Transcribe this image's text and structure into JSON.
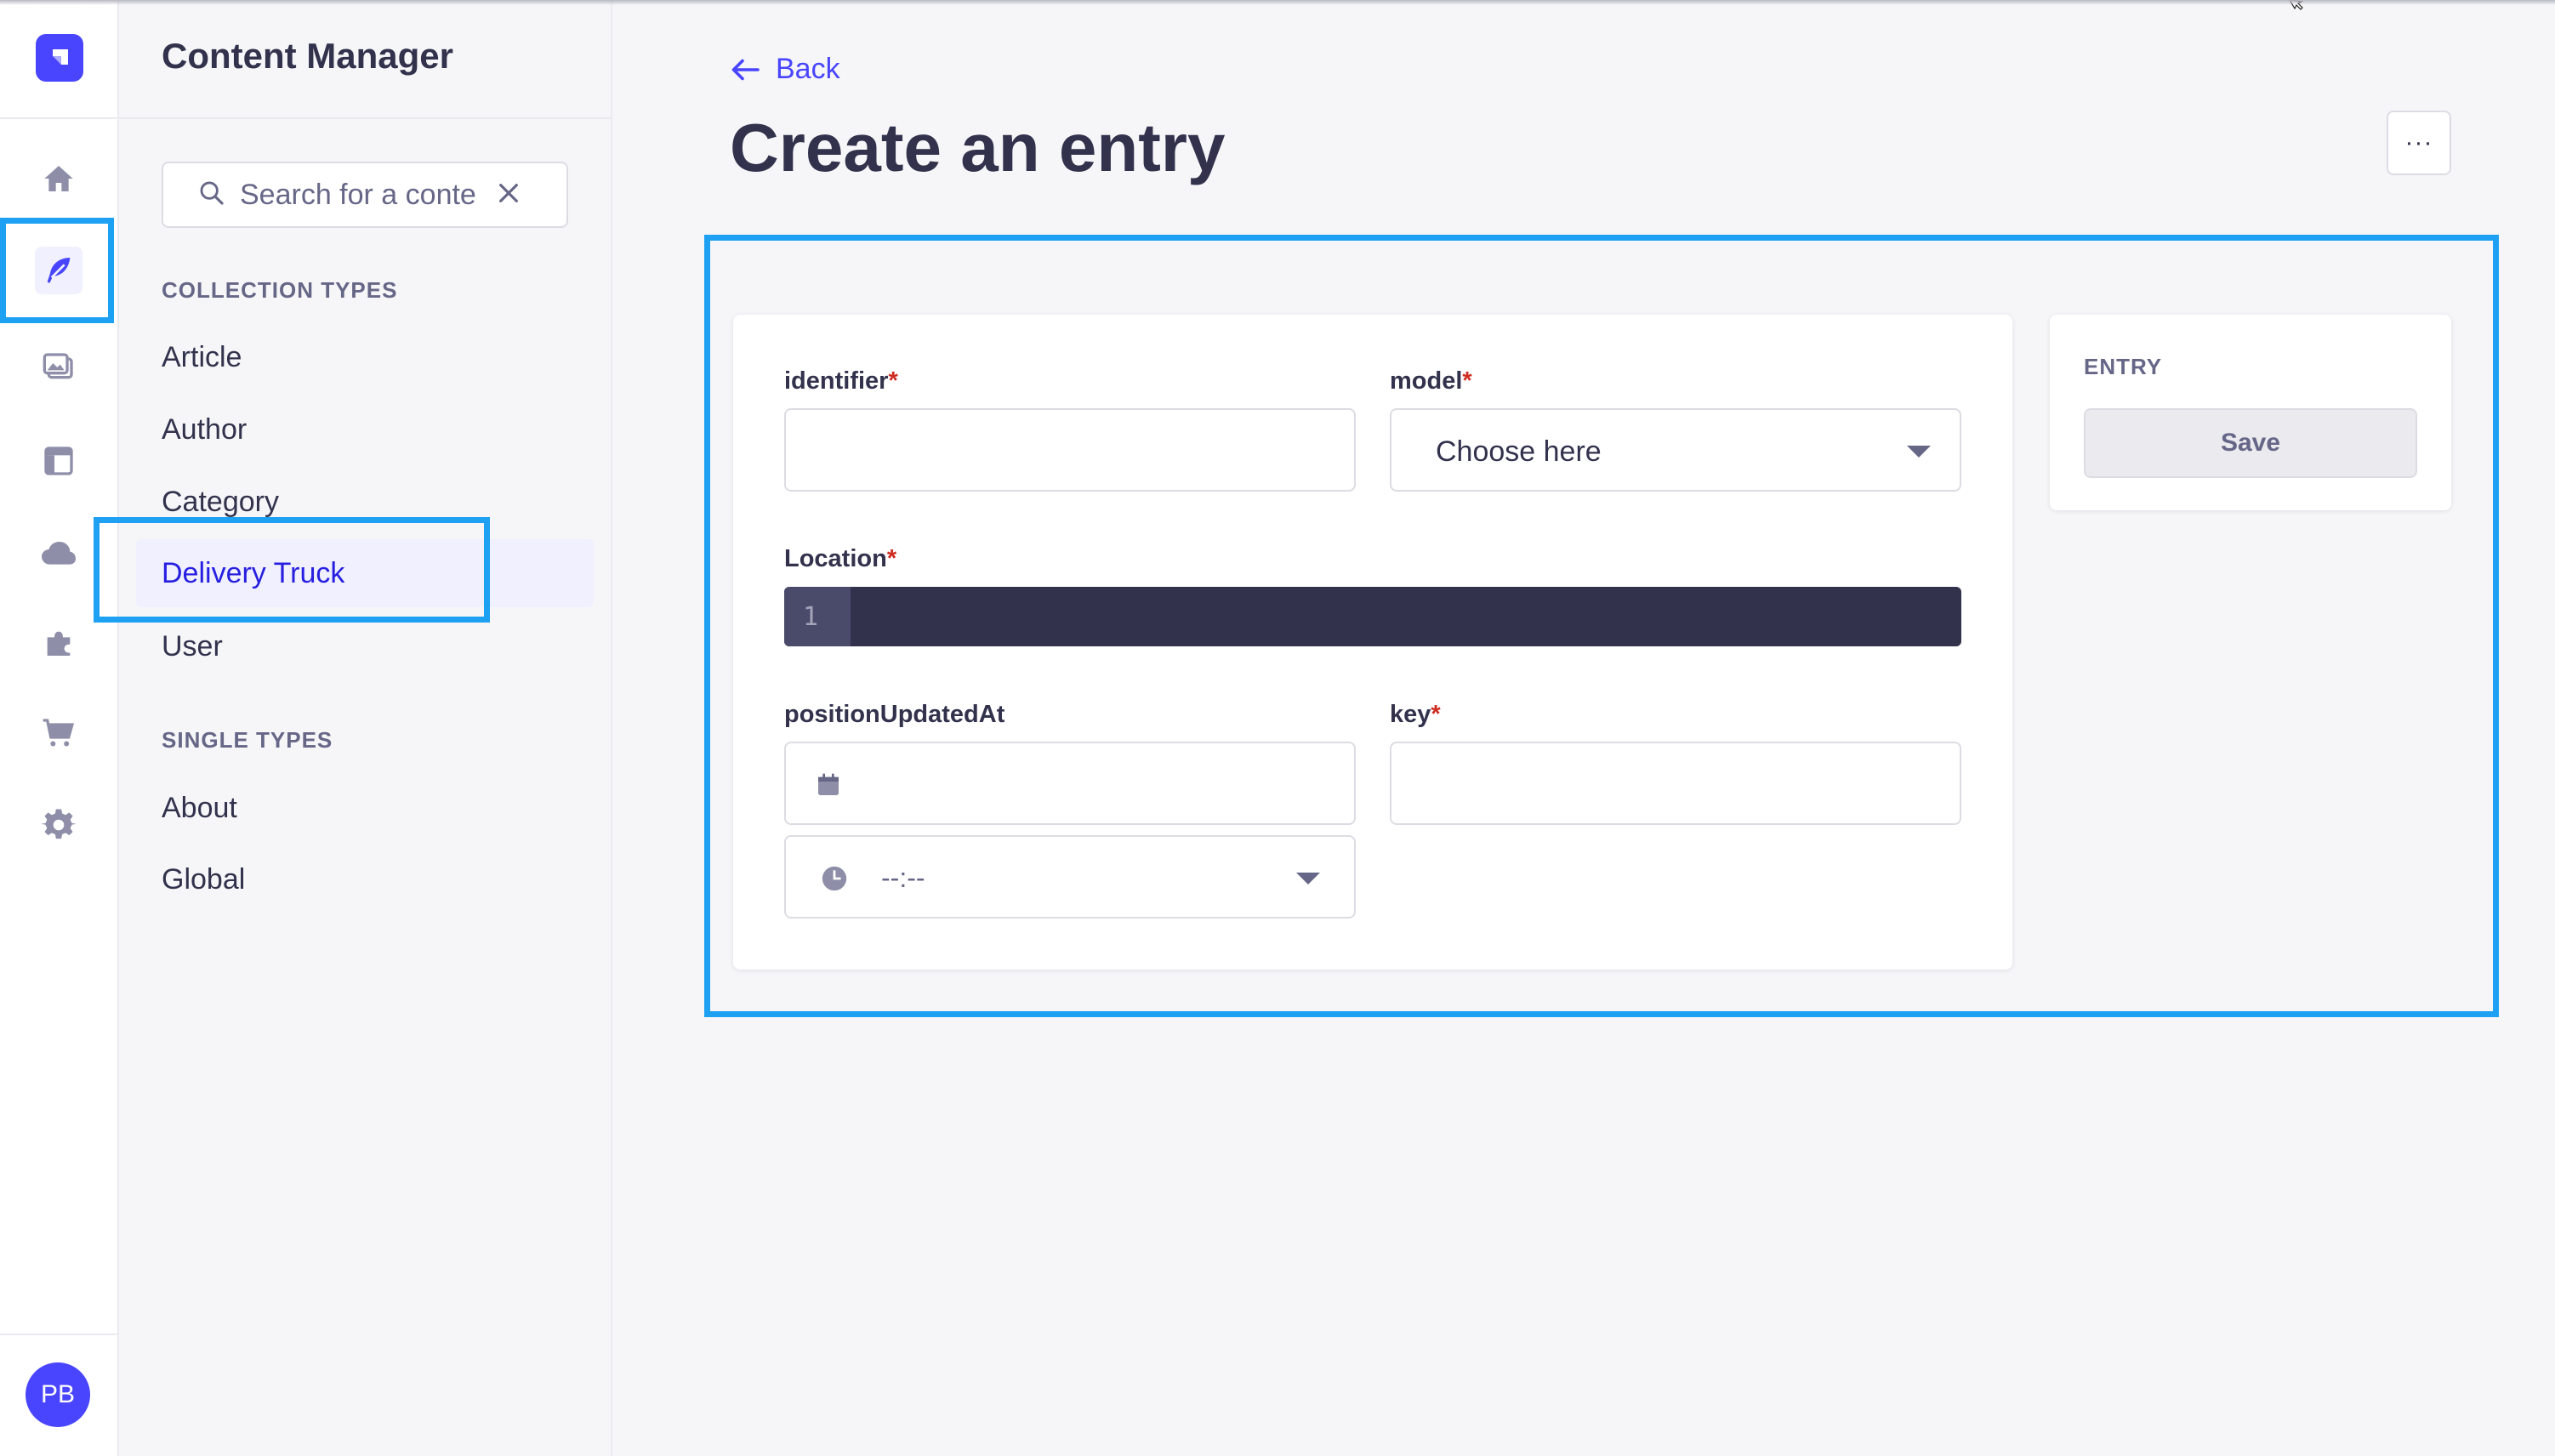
{
  "app": {
    "title": "Content Manager",
    "user_initials": "PB"
  },
  "rail": {
    "items": [
      {
        "icon": "home-icon"
      },
      {
        "icon": "content-manager-feather-icon",
        "active": true
      },
      {
        "icon": "media-library-icon"
      },
      {
        "icon": "content-type-builder-icon"
      },
      {
        "icon": "cloud-icon"
      },
      {
        "icon": "plugins-puzzle-icon"
      },
      {
        "icon": "marketplace-cart-icon"
      },
      {
        "icon": "settings-gear-icon"
      }
    ]
  },
  "sidebar": {
    "search_value": "Search for a conte",
    "collection_types_label": "COLLECTION TYPES",
    "collection_types": [
      "Article",
      "Author",
      "Category",
      "Delivery Truck",
      "User"
    ],
    "active_item": "Delivery Truck",
    "single_types_label": "SINGLE TYPES",
    "single_types": [
      "About",
      "Global"
    ]
  },
  "header": {
    "back_label": "Back",
    "title": "Create an entry",
    "more_label": "···"
  },
  "form": {
    "identifier_label": "identifier",
    "model_label": "model",
    "model_placeholder": "Choose here",
    "location_label": "Location",
    "location_line_number": "1",
    "position_updated_label": "positionUpdatedAt",
    "time_placeholder": "--:--",
    "key_label": "key",
    "required_mark": "*"
  },
  "entry_panel": {
    "label": "ENTRY",
    "save_label": "Save"
  },
  "colors": {
    "accent": "#4945ff",
    "highlight": "#1ea1f2",
    "required": "#d02b20",
    "code_bg": "#32324d"
  }
}
